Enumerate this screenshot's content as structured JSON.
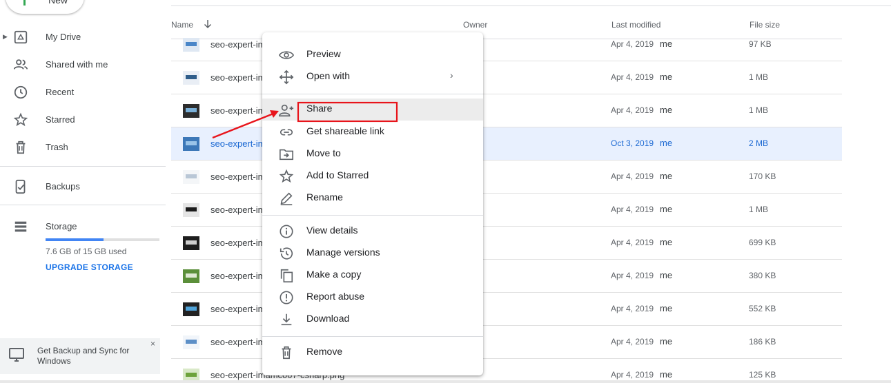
{
  "sidebar": {
    "new_label": "New",
    "items": [
      {
        "label": "My Drive",
        "icon": "drive-icon"
      },
      {
        "label": "Shared with me",
        "icon": "people-icon"
      },
      {
        "label": "Recent",
        "icon": "clock-icon"
      },
      {
        "label": "Starred",
        "icon": "star-icon"
      },
      {
        "label": "Trash",
        "icon": "trash-icon"
      },
      {
        "label": "Backups",
        "icon": "backup-phone-icon"
      },
      {
        "label": "Storage",
        "icon": "storage-icon"
      }
    ],
    "storage": {
      "used_text": "7.6 GB of 15 GB used",
      "upgrade_label": "UPGRADE STORAGE",
      "fraction_used": 0.507
    },
    "promo": {
      "text": "Get Backup and Sync for Windows",
      "close": "×"
    }
  },
  "list": {
    "headers": {
      "name": "Name",
      "owner": "Owner",
      "last_modified": "Last modified",
      "file_size": "File size"
    },
    "rows": [
      {
        "name": "seo-expert-im",
        "date": "Apr 4, 2019",
        "owner": "me",
        "size": "97 KB"
      },
      {
        "name": "seo-expert-im",
        "date": "Apr 4, 2019",
        "owner": "me",
        "size": "1 MB"
      },
      {
        "name": "seo-expert-im",
        "date": "Apr 4, 2019",
        "owner": "me",
        "size": "1 MB"
      },
      {
        "name": "seo-expert-im",
        "date": "Oct 3, 2019",
        "owner": "me",
        "size": "2 MB"
      },
      {
        "name": "seo-expert-im",
        "date": "Apr 4, 2019",
        "owner": "me",
        "size": "170 KB"
      },
      {
        "name": "seo-expert-im",
        "date": "Apr 4, 2019",
        "owner": "me",
        "size": "1 MB"
      },
      {
        "name": "seo-expert-im",
        "date": "Apr 4, 2019",
        "owner": "me",
        "size": "699 KB"
      },
      {
        "name": "seo-expert-im",
        "date": "Apr 4, 2019",
        "owner": "me",
        "size": "380 KB"
      },
      {
        "name": "seo-expert-im",
        "date": "Apr 4, 2019",
        "owner": "me",
        "size": "552 KB"
      },
      {
        "name": "seo-expert-im",
        "date": "Apr 4, 2019",
        "owner": "me",
        "size": "186 KB"
      },
      {
        "name": "seo-expert-imamc007-csharp.png",
        "date": "Apr 4, 2019",
        "owner": "me",
        "size": "125 KB"
      }
    ]
  },
  "context_menu": {
    "items": [
      {
        "label": "Preview",
        "icon": "eye-icon"
      },
      {
        "label": "Open with",
        "icon": "move-arrows-icon",
        "submenu": "›"
      },
      {
        "label": "Share",
        "icon": "add-person-icon"
      },
      {
        "label": "Get shareable link",
        "icon": "link-icon"
      },
      {
        "label": "Move to",
        "icon": "folder-move-icon"
      },
      {
        "label": "Add to Starred",
        "icon": "star-icon"
      },
      {
        "label": "Rename",
        "icon": "pencil-icon"
      },
      {
        "label": "View details",
        "icon": "info-icon"
      },
      {
        "label": "Manage versions",
        "icon": "history-icon"
      },
      {
        "label": "Make a copy",
        "icon": "copy-icon"
      },
      {
        "label": "Report abuse",
        "icon": "alert-icon"
      },
      {
        "label": "Download",
        "icon": "download-icon"
      },
      {
        "label": "Remove",
        "icon": "trash-icon"
      }
    ]
  },
  "colors": {
    "accent": "#1a73e8",
    "selected_row": "#e8f0fe",
    "annotation": "#e8141b"
  }
}
